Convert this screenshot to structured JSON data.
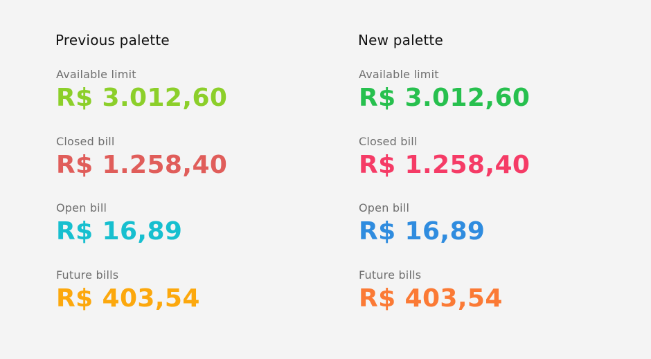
{
  "palettes": [
    {
      "title": "Previous palette",
      "items": [
        {
          "label": "Available limit",
          "value": "R$ 3.012,60",
          "color": "#8ccf2a"
        },
        {
          "label": "Closed bill",
          "value": "R$ 1.258,40",
          "color": "#e05d5a"
        },
        {
          "label": "Open bill",
          "value": "R$ 16,89",
          "color": "#17bfcf"
        },
        {
          "label": "Future bills",
          "value": "R$ 403,54",
          "color": "#fca80d"
        }
      ]
    },
    {
      "title": "New palette",
      "items": [
        {
          "label": "Available limit",
          "value": "R$ 3.012,60",
          "color": "#27c04e"
        },
        {
          "label": "Closed bill",
          "value": "R$ 1.258,40",
          "color": "#f53b66"
        },
        {
          "label": "Open bill",
          "value": "R$ 16,89",
          "color": "#2f8cdf"
        },
        {
          "label": "Future bills",
          "value": "R$ 403,54",
          "color": "#fb7a35"
        }
      ]
    }
  ]
}
